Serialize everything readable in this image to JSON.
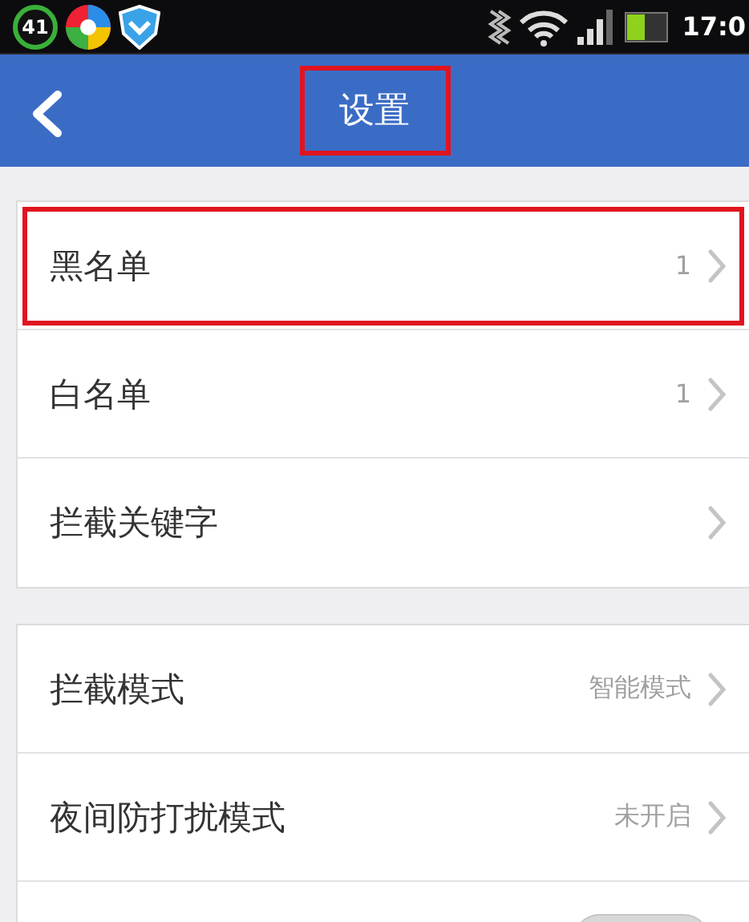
{
  "status_bar": {
    "badge": "41",
    "time": "17:0"
  },
  "title_bar": {
    "title": "设置",
    "highlighted": true
  },
  "groups": [
    {
      "rows": [
        {
          "kind": "link",
          "label": "黑名单",
          "value": "1",
          "highlighted": true
        },
        {
          "kind": "link",
          "label": "白名单",
          "value": "1",
          "highlighted": false
        },
        {
          "kind": "link",
          "label": "拦截关键字",
          "highlighted": false
        }
      ]
    },
    {
      "rows": [
        {
          "kind": "link",
          "label": "拦截模式",
          "value": "智能模式",
          "highlighted": false
        },
        {
          "kind": "link",
          "label": "夜间防打扰模式",
          "value": "未开启",
          "highlighted": false
        },
        {
          "kind": "toggle",
          "on": false
        }
      ]
    }
  ]
}
